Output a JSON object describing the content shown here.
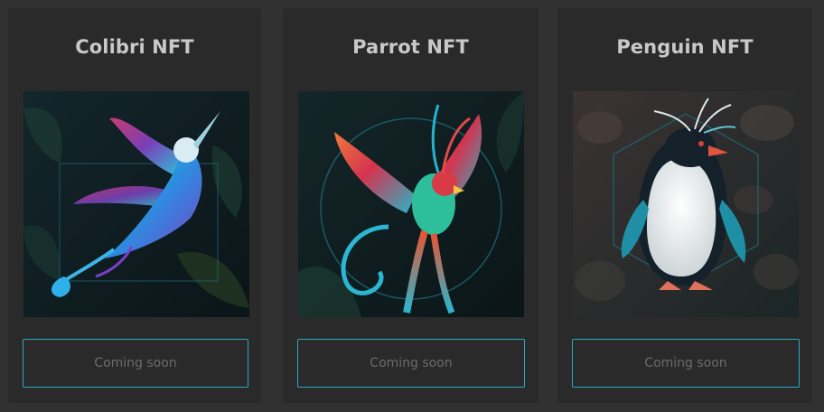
{
  "cards": [
    {
      "title": "Colibri NFT",
      "art_icon": "hummingbird-illustration",
      "button_label": "Coming soon"
    },
    {
      "title": "Parrot NFT",
      "art_icon": "parrot-illustration",
      "button_label": "Coming soon"
    },
    {
      "title": "Penguin NFT",
      "art_icon": "penguin-illustration",
      "button_label": "Coming soon"
    }
  ],
  "colors": {
    "page_background": "#313131",
    "card_background": "#2a2a2a",
    "title_text": "#c9c9c9",
    "button_border": "#2aa8c4",
    "button_text": "#6b6b6b"
  }
}
